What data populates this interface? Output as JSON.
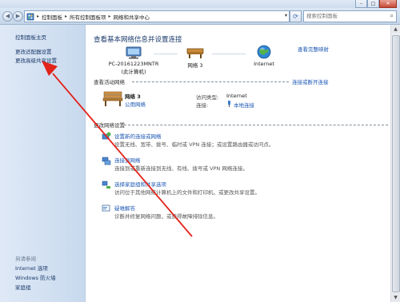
{
  "window": {
    "minimize": "–",
    "maximize": "□",
    "close": "✕"
  },
  "address": {
    "crumbs": [
      "控制面板",
      "所有控制面板项",
      "网络和共享中心"
    ],
    "sep": "▸",
    "search_placeholder": "搜索控制面板"
  },
  "sidebar": {
    "home": "控制面板主页",
    "items": [
      "更改适配器设置",
      "更改高级共享设置"
    ],
    "see_also": "另请参阅",
    "see_also_items": [
      "Internet 选项",
      "Windows 防火墙",
      "家庭组"
    ]
  },
  "main": {
    "title": "查看基本网络信息并设置连接",
    "full_map": "查看完整映射",
    "computer_name": "PC-20161223MNTR",
    "computer_sub": "(此计算机)",
    "network_node": "网络  3",
    "internet_node": "Internet",
    "active_header": "查看活动网络",
    "connect_disconnect": "连接或断开连接",
    "active_network_name": "网络  3",
    "active_network_type": "公用网络",
    "access_type_label": "访问类型:",
    "access_type_value": "Internet",
    "connection_label": "连接:",
    "connection_value": "本地连接",
    "change_header": "更改网络设置",
    "items": [
      {
        "title": "设置新的连接或网络",
        "desc": "设置无线、宽带、拨号、临时或 VPN 连接；或设置路由器或访问点。"
      },
      {
        "title": "连接到网络",
        "desc": "连接到或重新连接到无线、有线、拨号或 VPN 网络连接。"
      },
      {
        "title": "选择家庭组和共享选项",
        "desc": "访问位于其他网络计算机上的文件和打印机，或更改共享设置。"
      },
      {
        "title": "疑难解答",
        "desc": "诊断并修复网络问题，或获得故障排除信息。"
      }
    ]
  },
  "colors": {
    "link": "#1a56b3",
    "annotation_arrow": "#e2231a"
  }
}
